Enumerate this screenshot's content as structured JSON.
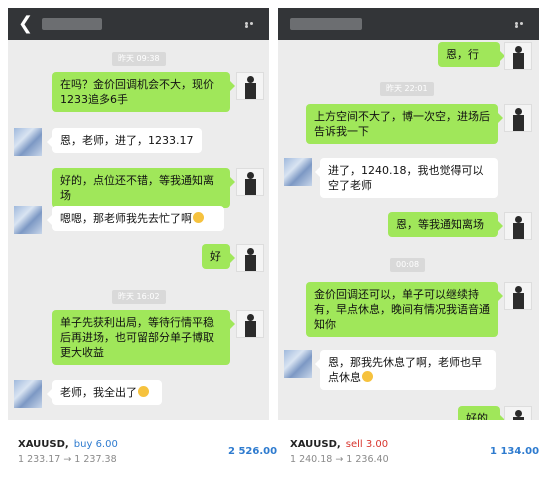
{
  "left": {
    "timestamps": [
      "昨天 09:38",
      "昨天 16:02"
    ],
    "messages": [
      {
        "side": "out",
        "text": "在吗？金价回调机会不大，现价1233追多6手"
      },
      {
        "side": "in",
        "text": "恩，老师，进了，1233.17"
      },
      {
        "side": "out",
        "text": "好的，点位还不错，等我通知离场"
      },
      {
        "side": "in",
        "text": "嗯嗯，那老师我先去忙了啊"
      },
      {
        "side": "out",
        "text": "好"
      },
      {
        "side": "out",
        "text": "单子先获利出局，等待行情平稳后再进场，也可留部分单子博取更大收益"
      },
      {
        "side": "in",
        "text": "老师，我全出了"
      }
    ],
    "ticker": {
      "symbol": "XAUUSD,",
      "side": "buy 6.00",
      "prices": "1 233.17 → 1 237.38",
      "profit": "2 526.00"
    }
  },
  "right": {
    "timestamps": [
      "昨天 22:01",
      "00:08"
    ],
    "messages": [
      {
        "side": "out",
        "text": "恩，行"
      },
      {
        "side": "out",
        "text": "上方空间不大了，博一次空，进场后告诉我一下"
      },
      {
        "side": "in",
        "text": "进了，1240.18，我也觉得可以空了老师"
      },
      {
        "side": "out",
        "text": "恩，等我通知离场"
      },
      {
        "side": "out",
        "text": "金价回调还可以，单子可以继续持有，早点休息，晚间有情况我语音通知你"
      },
      {
        "side": "in",
        "text": "恩，那我先休息了啊，老师也早点休息"
      },
      {
        "side": "out",
        "text": "好的"
      }
    ],
    "ticker": {
      "symbol": "XAUUSD,",
      "side": "sell 3.00",
      "prices": "1 240.18 → 1 236.40",
      "profit": "1 134.00"
    }
  },
  "icons": [
    "back-arrow-icon",
    "more-dots-icon",
    "smile-emoji-icon",
    "grin-emoji-icon"
  ]
}
